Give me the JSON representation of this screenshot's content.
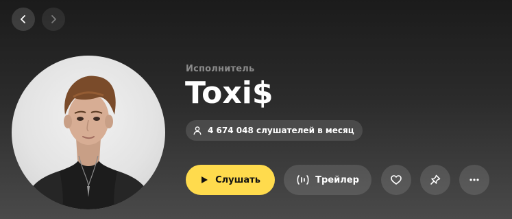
{
  "header": {
    "back_icon": "chevron-left-icon",
    "forward_icon": "chevron-right-icon"
  },
  "artist": {
    "type_label": "Исполнитель",
    "name": "Toxi$",
    "listeners_icon": "person-icon",
    "listeners_text": "4 674 048 слушателей в месяц"
  },
  "actions": {
    "play_label": "Слушать",
    "play_color": "#ffdb4d",
    "trailer_label": "Трейлер",
    "like_icon": "heart-icon",
    "pin_icon": "pin-icon",
    "more_icon": "more-icon"
  }
}
